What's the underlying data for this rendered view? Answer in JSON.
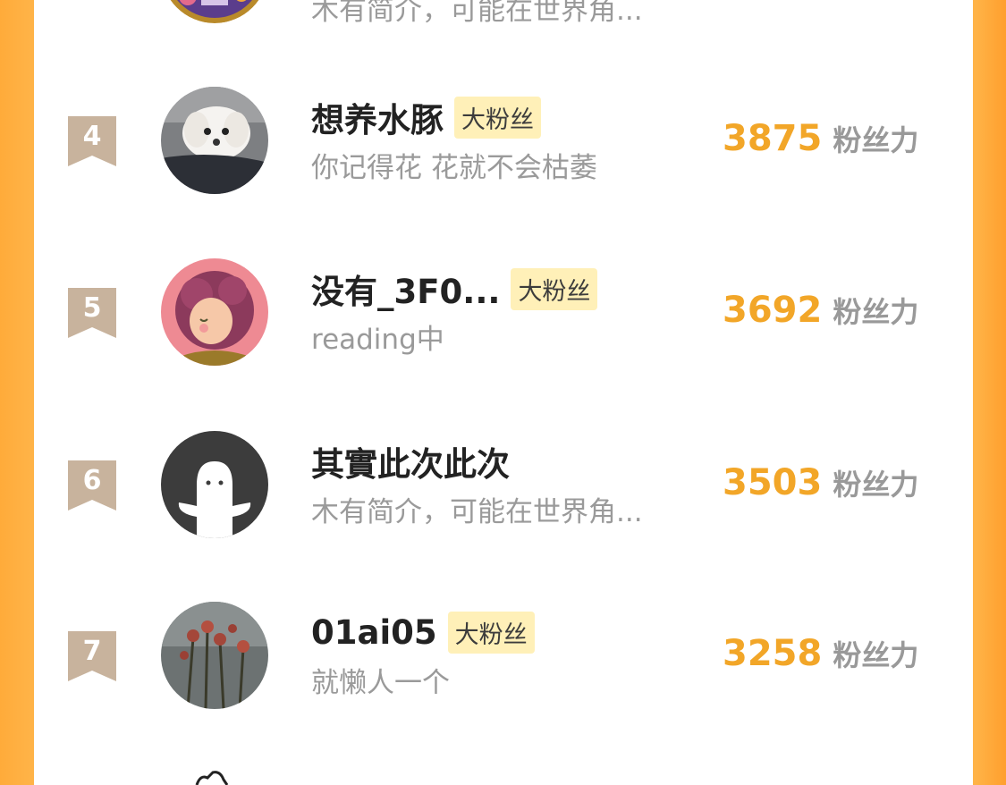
{
  "colors": {
    "background_orange": "#ffb347",
    "panel": "#ffffff",
    "score": "#f2a628",
    "fan_tag_bg": "#fff0b8",
    "rank_badge": "#c8b39d"
  },
  "partial_top_row": {
    "bio": "木有简介，可能在世界角..."
  },
  "rows": [
    {
      "rank": "4",
      "name": "想养水豚",
      "tag": "大粉丝",
      "bio": "你记得花 花就不会枯萎",
      "score": "3875",
      "unit": "粉丝力",
      "avatar": "white-puppy-avatar"
    },
    {
      "rank": "5",
      "name": "没有_3F0...",
      "tag": "大粉丝",
      "bio": "reading中",
      "score": "3692",
      "unit": "粉丝力",
      "avatar": "cartoon-girl-avatar"
    },
    {
      "rank": "6",
      "name": "其實此次此次",
      "tag": "",
      "bio": "木有简介，可能在世界角...",
      "score": "3503",
      "unit": "粉丝力",
      "avatar": "default-ghost-avatar"
    },
    {
      "rank": "7",
      "name": "01ai05",
      "tag": "大粉丝",
      "bio": "就懒人一个",
      "score": "3258",
      "unit": "粉丝力",
      "avatar": "roses-avatar"
    }
  ]
}
